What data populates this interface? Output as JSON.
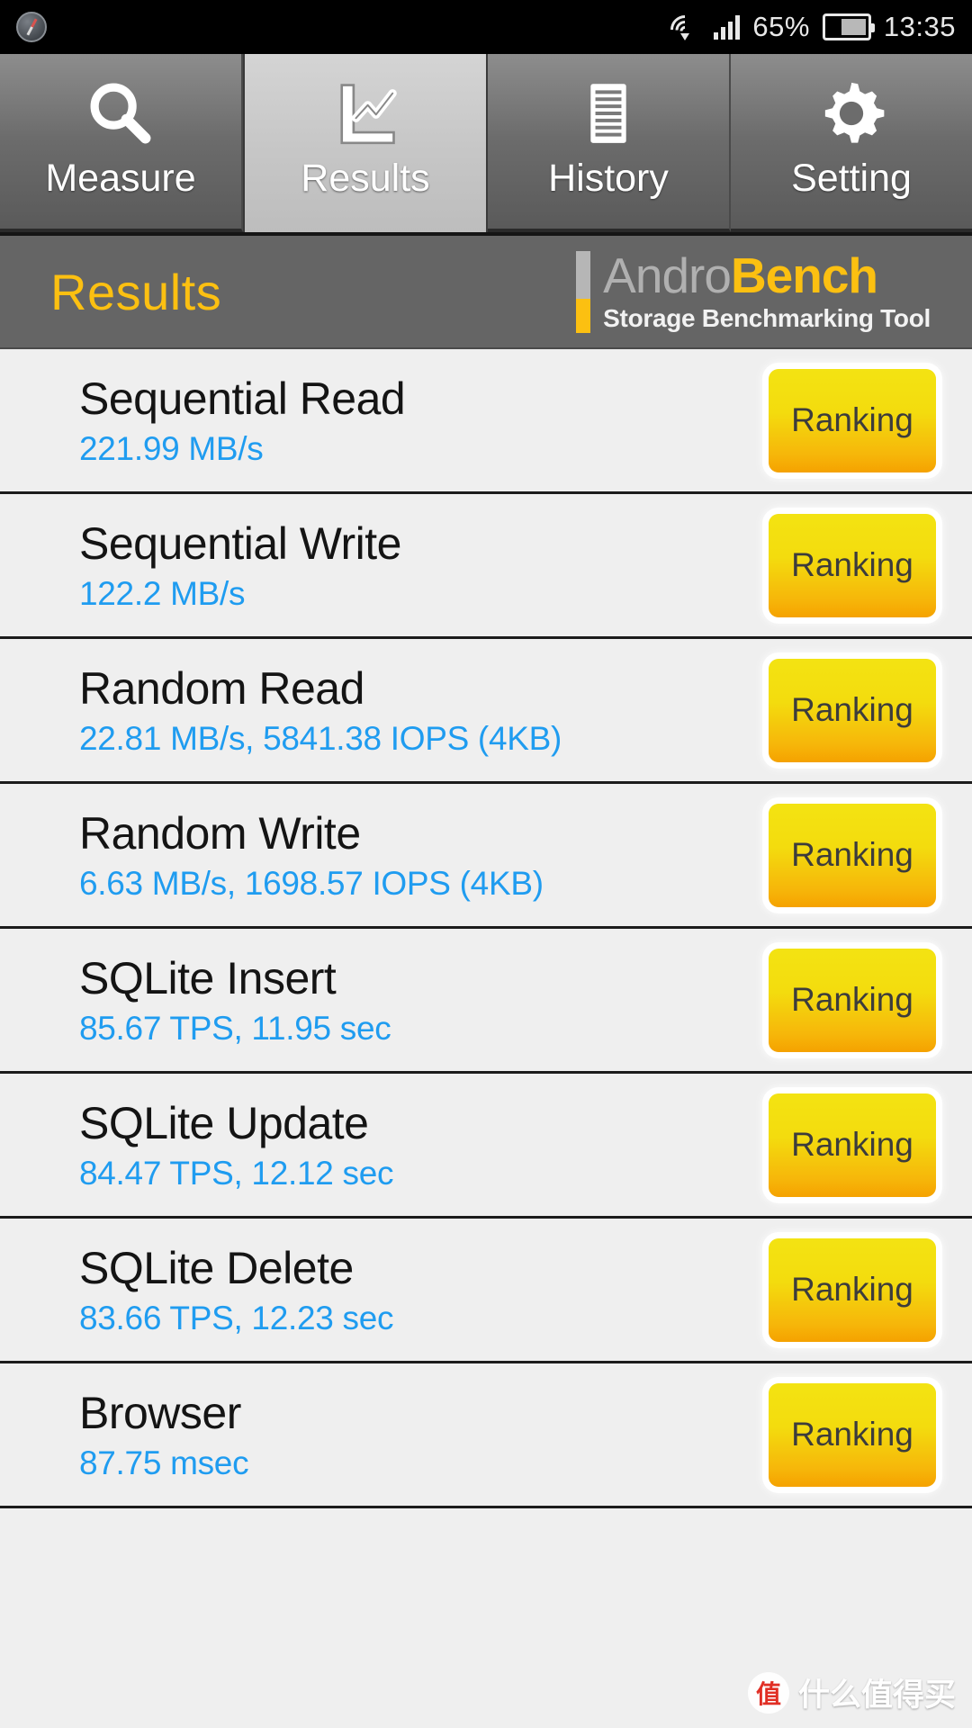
{
  "statusbar": {
    "compass_icon": "compass-icon",
    "wifi_icon": "wifi-icon",
    "signal_icon": "cellular-signal-icon",
    "battery_percent": "65%",
    "battery_icon": "battery-icon",
    "time": "13:35"
  },
  "tabs": [
    {
      "label": "Measure",
      "icon": "search-icon",
      "active": false
    },
    {
      "label": "Results",
      "icon": "chart-icon",
      "active": true
    },
    {
      "label": "History",
      "icon": "document-icon",
      "active": false
    },
    {
      "label": "Setting",
      "icon": "gear-icon",
      "active": false
    }
  ],
  "header": {
    "title": "Results",
    "brand_prefix": "Andro",
    "brand_suffix": "Bench",
    "brand_tagline": "Storage Benchmarking Tool"
  },
  "colors": {
    "accent_yellow": "#fcc011",
    "value_blue": "#1f9cf0",
    "header_gray": "#656565",
    "list_bg": "#efefef",
    "button_top": "#f3e312",
    "button_bottom": "#f5a200"
  },
  "results": [
    {
      "title": "Sequential Read",
      "value": "221.99 MB/s",
      "button": "Ranking"
    },
    {
      "title": "Sequential Write",
      "value": "122.2 MB/s",
      "button": "Ranking"
    },
    {
      "title": "Random Read",
      "value": "22.81 MB/s, 5841.38 IOPS (4KB)",
      "button": "Ranking"
    },
    {
      "title": "Random Write",
      "value": "6.63 MB/s, 1698.57 IOPS (4KB)",
      "button": "Ranking"
    },
    {
      "title": "SQLite Insert",
      "value": "85.67 TPS, 11.95 sec",
      "button": "Ranking"
    },
    {
      "title": "SQLite Update",
      "value": "84.47 TPS, 12.12 sec",
      "button": "Ranking"
    },
    {
      "title": "SQLite Delete",
      "value": "83.66 TPS, 12.23 sec",
      "button": "Ranking"
    },
    {
      "title": "Browser",
      "value": "87.75 msec",
      "button": "Ranking"
    }
  ],
  "watermark": {
    "logo": "值",
    "text": "什么值得买"
  }
}
